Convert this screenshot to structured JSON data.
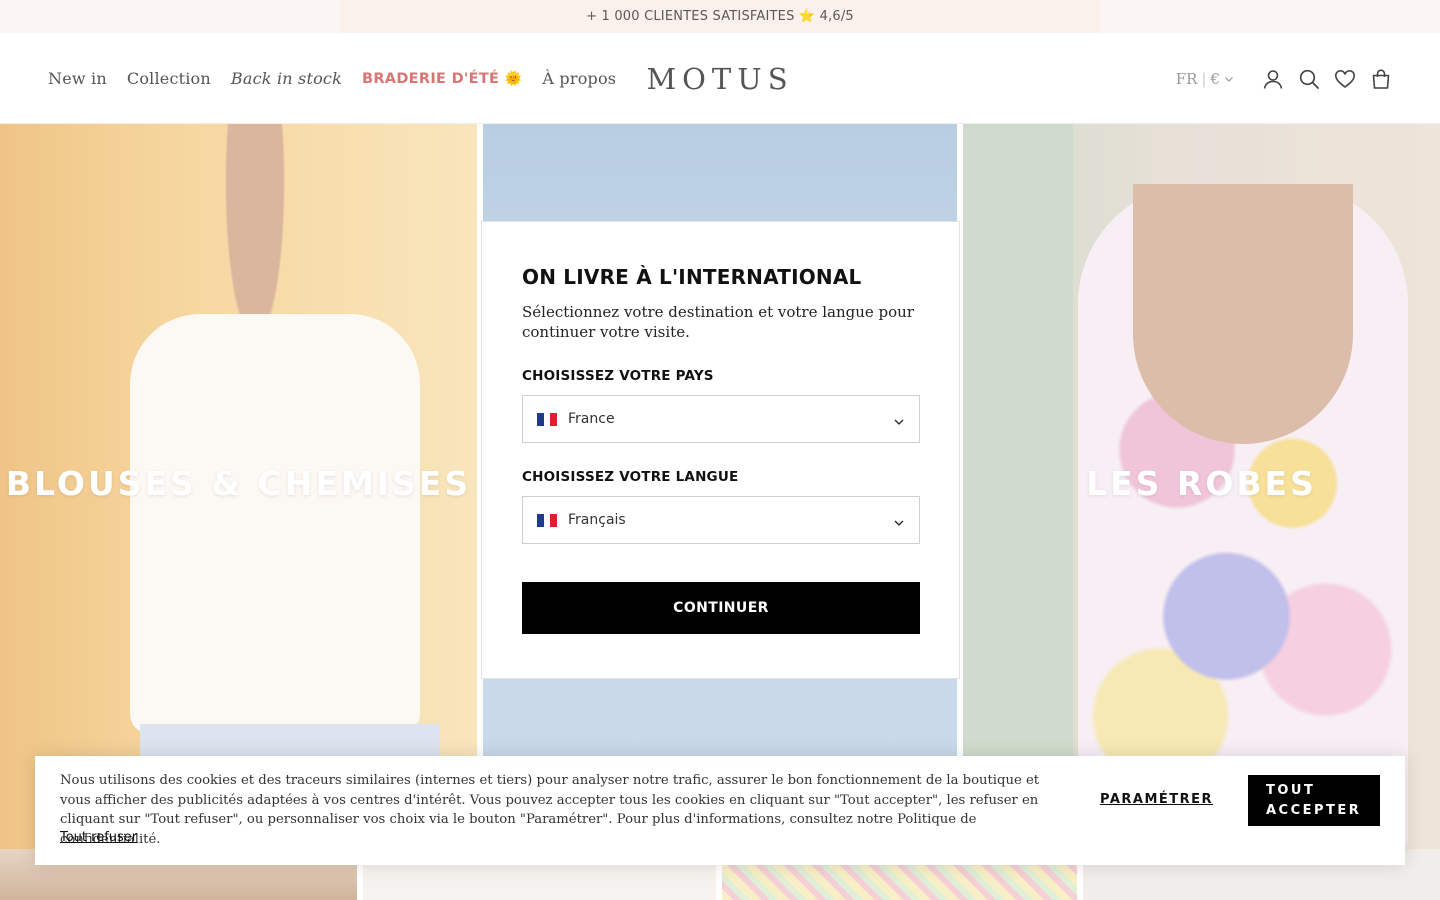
{
  "announcement": {
    "text": "+ 1 000 CLIENTES SATISFAITES ⭐ 4,6/5"
  },
  "header": {
    "nav": [
      {
        "label": "New in"
      },
      {
        "label": "Collection"
      },
      {
        "label": "Back in stock"
      },
      {
        "label": "BRADERIE D'ÉTÉ"
      },
      {
        "label": "À propos"
      }
    ],
    "sale_emoji": "🌞",
    "logo": "MOTUS",
    "locale_lang": "FR",
    "locale_sep": "|",
    "locale_currency": "€",
    "icons": [
      "account-icon",
      "search-icon",
      "wishlist-icon",
      "cart-icon"
    ]
  },
  "hero": {
    "left_title": "BLOUSES & CHEMISES",
    "right_title": "LES ROBES"
  },
  "modal": {
    "title": "ON LIVRE À L'INTERNATIONAL",
    "subtitle": "Sélectionnez votre destination et votre langue pour continuer votre visite.",
    "country_label": "CHOISISSEZ VOTRE PAYS",
    "country_value": "France",
    "language_label": "CHOISISSEZ VOTRE LANGUE",
    "language_value": "Français",
    "continue_label": "CONTINUER"
  },
  "cookie": {
    "text": "Nous utilisons des cookies et des traceurs similaires (internes et tiers) pour analyser notre trafic, assurer le bon fonctionnement de la boutique et vous afficher des publicités adaptées à vos centres d'intérêt. Vous pouvez accepter tous les cookies en cliquant sur \"Tout accepter\", les refuser en cliquant sur \"Tout refuser\", ou personnaliser vos choix via le bouton \"Paramétrer\". Pour plus d'informations, consultez notre Politique de confidentialité.",
    "refuse_label": "Tout refuser",
    "settings_label": "PARAMÉTRER",
    "accept_line1": "TOUT",
    "accept_line2": "ACCEPTER"
  },
  "colors": {
    "sale": "#d97575",
    "announce_bg": "#fbf1ec",
    "button_bg": "#000000",
    "flag_blue": "#1e3a8a",
    "flag_white": "#ffffff",
    "flag_red": "#e11d2e"
  }
}
